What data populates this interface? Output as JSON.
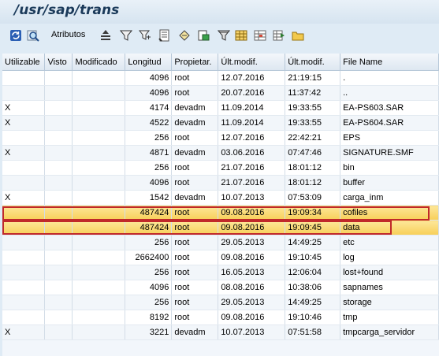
{
  "window": {
    "title": "/usr/sap/trans"
  },
  "toolbar": {
    "atributos_label": "Atributos",
    "icons": [
      "refresh-icon",
      "search-icon",
      "align-icon",
      "filter-funnel-icon",
      "filter-set-icon",
      "sum-icon",
      "subtotal-icon",
      "print-preview-icon",
      "export-icon",
      "layout-icon",
      "grid-icon",
      "select-layout-icon",
      "folder-icon"
    ]
  },
  "table": {
    "headers": [
      "Utilizable",
      "Visto",
      "Modificado",
      "Longitud",
      "Propietar.",
      "Últ.modif.",
      "Últ.modif.",
      "File Name"
    ],
    "rows": [
      [
        "",
        "",
        "",
        "4096",
        "root",
        "12.07.2016",
        "21:19:15",
        "."
      ],
      [
        "",
        "",
        "",
        "4096",
        "root",
        "20.07.2016",
        "11:37:42",
        ".."
      ],
      [
        "X",
        "",
        "",
        "4174",
        "devadm",
        "11.09.2014",
        "19:33:55",
        "EA-PS603.SAR"
      ],
      [
        "X",
        "",
        "",
        "4522",
        "devadm",
        "11.09.2014",
        "19:33:55",
        "EA-PS604.SAR"
      ],
      [
        "",
        "",
        "",
        "256",
        "root",
        "12.07.2016",
        "22:42:21",
        "EPS"
      ],
      [
        "X",
        "",
        "",
        "4871",
        "devadm",
        "03.06.2016",
        "07:47:46",
        "SIGNATURE.SMF"
      ],
      [
        "",
        "",
        "",
        "256",
        "root",
        "21.07.2016",
        "18:01:12",
        "bin"
      ],
      [
        "",
        "",
        "",
        "4096",
        "root",
        "21.07.2016",
        "18:01:12",
        "buffer"
      ],
      [
        "X",
        "",
        "",
        "1542",
        "devadm",
        "10.07.2013",
        "07:53:09",
        "carga_inm"
      ],
      [
        "",
        "",
        "",
        "487424",
        "root",
        "09.08.2016",
        "19:09:34",
        "cofiles"
      ],
      [
        "",
        "",
        "",
        "487424",
        "root",
        "09.08.2016",
        "19:09:45",
        "data"
      ],
      [
        "",
        "",
        "",
        "256",
        "root",
        "29.05.2013",
        "14:49:25",
        "etc"
      ],
      [
        "",
        "",
        "",
        "2662400",
        "root",
        "09.08.2016",
        "19:10:45",
        "log"
      ],
      [
        "",
        "",
        "",
        "256",
        "root",
        "16.05.2013",
        "12:06:04",
        "lost+found"
      ],
      [
        "",
        "",
        "",
        "4096",
        "root",
        "08.08.2016",
        "10:38:06",
        "sapnames"
      ],
      [
        "",
        "",
        "",
        "256",
        "root",
        "29.05.2013",
        "14:49:25",
        "storage"
      ],
      [
        "",
        "",
        "",
        "8192",
        "root",
        "09.08.2016",
        "19:10:46",
        "tmp"
      ],
      [
        "X",
        "",
        "",
        "3221",
        "devadm",
        "10.07.2013",
        "07:51:58",
        "tmpcarga_servidor"
      ]
    ],
    "highlighted_rows": [
      9,
      10
    ]
  },
  "colors": {
    "highlight": "#f7cf58",
    "annotation_box": "#c0282a",
    "title": "#1b3a5a"
  }
}
